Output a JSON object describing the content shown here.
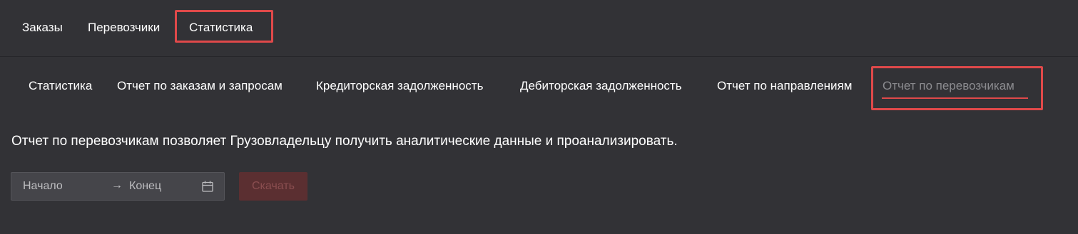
{
  "top_nav": {
    "items": [
      {
        "label": "Заказы"
      },
      {
        "label": "Перевозчики"
      },
      {
        "label": "Статистика",
        "active": true
      }
    ]
  },
  "sub_nav": {
    "items": [
      {
        "label": "Статистика"
      },
      {
        "label": "Отчет по заказам и запросам"
      },
      {
        "label": "Кредиторская задолженность"
      },
      {
        "label": "Дебиторская задолженность"
      },
      {
        "label": "Отчет по направлениям"
      },
      {
        "label": "Отчет по перевозчикам",
        "active": true
      }
    ]
  },
  "description": "Отчет по перевозчикам позволяет Грузовладельцу получить аналитические данные и проанализировать.",
  "date_range": {
    "start_placeholder": "Начало",
    "separator": "→",
    "end_placeholder": "Конец",
    "icon": "calendar-icon"
  },
  "download_button": {
    "label": "Скачать",
    "disabled": true
  },
  "colors": {
    "background": "#323236",
    "highlight": "#e0494a",
    "text": "#ffffff",
    "muted_text": "#8c8c90",
    "input_bg": "#45454a",
    "disabled_button_bg": "#5b2f31"
  }
}
